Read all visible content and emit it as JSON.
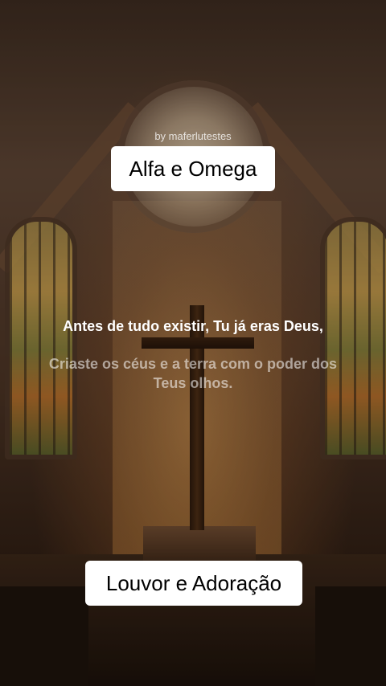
{
  "video": {
    "credit": "by maferlutestes",
    "title_sticker": "Alfa e Omega",
    "bottom_sticker": "Louvor e Adoração"
  },
  "lyrics": {
    "current_line": "Antes de tudo existir, Tu já eras Deus,",
    "next_line": "Criaste os céus e a terra com o poder dos Teus olhos."
  },
  "colors": {
    "sticker_bg": "#ffffff",
    "lyric_active": "#ffffff"
  }
}
